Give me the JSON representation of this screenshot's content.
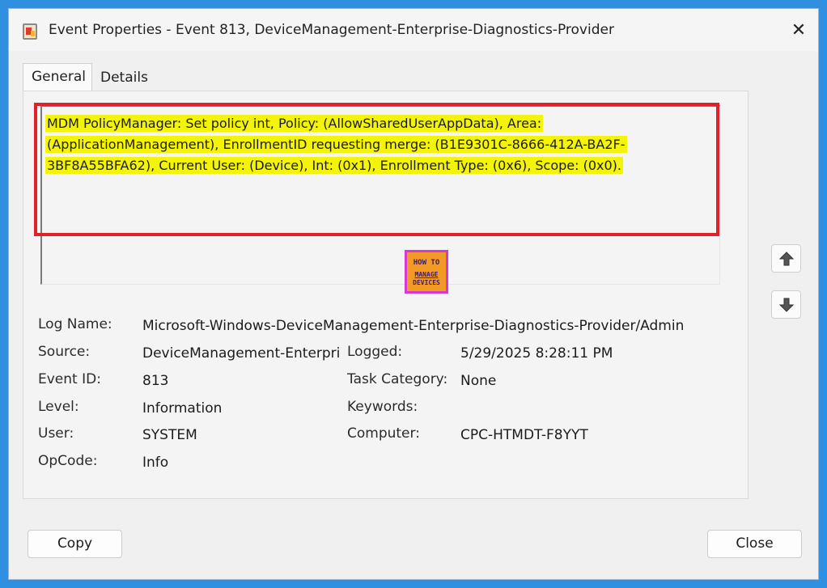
{
  "window": {
    "title": "Event Properties - Event 813, DeviceManagement-Enterprise-Diagnostics-Provider",
    "close_glyph": "✕"
  },
  "tabs": [
    {
      "label": "General",
      "selected": true
    },
    {
      "label": "Details",
      "selected": false
    }
  ],
  "description": {
    "text": "MDM PolicyManager: Set policy int, Policy: (AllowSharedUserAppData), Area: (ApplicationManagement), EnrollmentID requesting merge: (B1E9301C-8666-412A-BA2F-3BF8A55BFA62), Current User: (Device), Int: (0x1), Enrollment Type: (0x6), Scope: (0x0).",
    "highlight_color": "#f4f30a",
    "annotation_color": "#e0202a"
  },
  "watermark": {
    "line1": "HOW TO",
    "line2": "MANAGE",
    "line3": "DEVICES"
  },
  "fields": {
    "log_name": {
      "label": "Log Name:",
      "value": "Microsoft-Windows-DeviceManagement-Enterprise-Diagnostics-Provider/Admin"
    },
    "source": {
      "label": "Source:",
      "value": "DeviceManagement-Enterpri"
    },
    "logged": {
      "label": "Logged:",
      "value": "5/29/2025 8:28:11 PM"
    },
    "event_id": {
      "label": "Event ID:",
      "value": "813"
    },
    "task_category": {
      "label": "Task Category:",
      "value": "None"
    },
    "level": {
      "label": "Level:",
      "value": "Information"
    },
    "keywords": {
      "label": "Keywords:",
      "value": ""
    },
    "user": {
      "label": "User:",
      "value": "SYSTEM"
    },
    "computer": {
      "label": "Computer:",
      "value": "CPC-HTMDT-F8YYT"
    },
    "opcode": {
      "label": "OpCode:",
      "value": "Info"
    }
  },
  "nav": {
    "up_icon": "arrow-up-icon",
    "down_icon": "arrow-down-icon"
  },
  "buttons": {
    "copy": "Copy",
    "close": "Close"
  },
  "colors": {
    "background": "#2f8fe0",
    "window": "#f0f0f0"
  }
}
